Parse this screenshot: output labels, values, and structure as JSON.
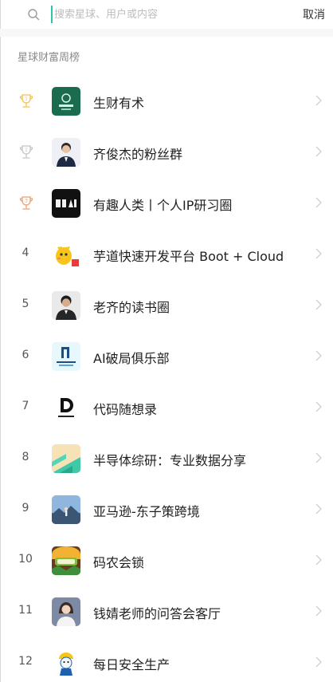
{
  "search": {
    "placeholder": "搜索星球、用户或内容",
    "cancel_label": "取消"
  },
  "section": {
    "title": "星球财富周榜"
  },
  "ranking": [
    {
      "rank": "1",
      "trophy": "gold",
      "name": "生财有术",
      "avatar_icon": "shengcai-logo"
    },
    {
      "rank": "2",
      "trophy": "silver",
      "name": "齐俊杰的粉丝群",
      "avatar_icon": "man-in-suit-photo"
    },
    {
      "rank": "3",
      "trophy": "bronze",
      "name": "有趣人类丨个人IP研习圈",
      "avatar_icon": "black-logo-youqu"
    },
    {
      "rank": "4",
      "trophy": "",
      "name": "芋道快速开发平台 Boot + Cloud",
      "avatar_icon": "yellow-mascot"
    },
    {
      "rank": "5",
      "trophy": "",
      "name": "老齐的读书圈",
      "avatar_icon": "man-portrait-photo"
    },
    {
      "rank": "6",
      "trophy": "",
      "name": "AI破局俱乐部",
      "avatar_icon": "ai-pojü-logo"
    },
    {
      "rank": "7",
      "trophy": "",
      "name": "代码随想录",
      "avatar_icon": "letter-d-logo"
    },
    {
      "rank": "8",
      "trophy": "",
      "name": "半导体综研：专业数据分享",
      "avatar_icon": "green-geometric-logo"
    },
    {
      "rank": "9",
      "trophy": "",
      "name": "亚马逊-东子策跨境",
      "avatar_icon": "landscape-photo"
    },
    {
      "rank": "10",
      "trophy": "",
      "name": "码农会锁",
      "avatar_icon": "colorful-cartoon"
    },
    {
      "rank": "11",
      "trophy": "",
      "name": "钱婧老师的问答会客厅",
      "avatar_icon": "woman-portrait-photo"
    },
    {
      "rank": "12",
      "trophy": "",
      "name": "每日安全生产",
      "avatar_icon": "safety-mascot"
    }
  ],
  "colors": {
    "gold": "#f3c04a",
    "silver": "#c4c4c4",
    "bronze": "#e9a06b",
    "accent": "#2ec4a6"
  }
}
